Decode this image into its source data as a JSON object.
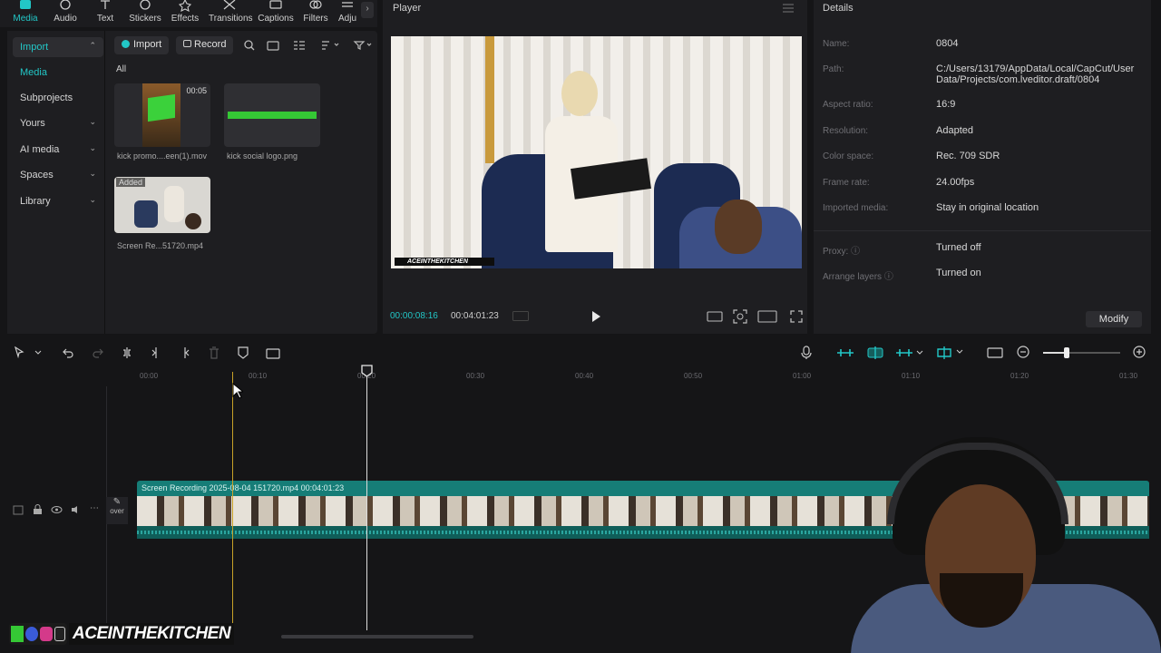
{
  "toolbar": {
    "tabs": [
      {
        "label": "Media",
        "icon": "media-icon",
        "active": true
      },
      {
        "label": "Audio",
        "icon": "audio-icon"
      },
      {
        "label": "Text",
        "icon": "text-icon"
      },
      {
        "label": "Stickers",
        "icon": "stickers-icon"
      },
      {
        "label": "Effects",
        "icon": "effects-icon"
      },
      {
        "label": "Transitions",
        "icon": "transitions-icon"
      },
      {
        "label": "Captions",
        "icon": "captions-icon"
      },
      {
        "label": "Filters",
        "icon": "filters-icon"
      },
      {
        "label": "Adju",
        "icon": "adjust-icon"
      }
    ]
  },
  "sidebar": {
    "items": [
      {
        "label": "Import",
        "chevron": "⌃"
      },
      {
        "label": "Media"
      },
      {
        "label": "Subprojects"
      },
      {
        "label": "Yours",
        "chevron": "⌄"
      },
      {
        "label": "AI media",
        "chevron": "⌄"
      },
      {
        "label": "Spaces",
        "chevron": "⌄"
      },
      {
        "label": "Library",
        "chevron": "⌄"
      }
    ]
  },
  "media": {
    "import_label": "Import",
    "record_label": "Record",
    "filter_label": "All",
    "items": [
      {
        "name": "kick promo....een(1).mov",
        "duration": "00:05"
      },
      {
        "name": "kick social logo.png"
      },
      {
        "name": "Screen Re...51720.mp4",
        "badge": "Added"
      }
    ]
  },
  "player": {
    "title": "Player",
    "current_time": "00:00:08:16",
    "total_time": "00:04:01:23",
    "video_watermark": "ACEINTHEKITCHEN"
  },
  "details": {
    "title": "Details",
    "rows": [
      {
        "key": "Name:",
        "value": "0804"
      },
      {
        "key": "Path:",
        "value": "C:/Users/13179/AppData/Local/CapCut/User Data/Projects/com.lveditor.draft/0804"
      },
      {
        "key": "Aspect ratio:",
        "value": "16:9"
      },
      {
        "key": "Resolution:",
        "value": "Adapted"
      },
      {
        "key": "Color space:",
        "value": "Rec. 709 SDR"
      },
      {
        "key": "Frame rate:",
        "value": "24.00fps"
      },
      {
        "key": "Imported media:",
        "value": "Stay in original location"
      },
      {
        "key": "Proxy:",
        "value": "Turned off"
      },
      {
        "key": "Arrange layers",
        "value": "Turned on"
      }
    ],
    "modify_label": "Modify"
  },
  "timeline": {
    "ticks": [
      "00:00",
      "00:10",
      "00:20",
      "00:30",
      "00:40",
      "00:50",
      "01:00",
      "01:10",
      "01:20",
      "01:30"
    ],
    "clip_label": "Screen Recording 2025-08-04 151720.mp4   00:04:01:23",
    "cover_label": "over"
  },
  "overlay": {
    "watermark": "ACEINTHEKITCHEN"
  },
  "colors": {
    "accent": "#22c7c7",
    "clip": "#167d77",
    "playhead": "#e0e0e0",
    "cursor_line": "#c9a227"
  }
}
